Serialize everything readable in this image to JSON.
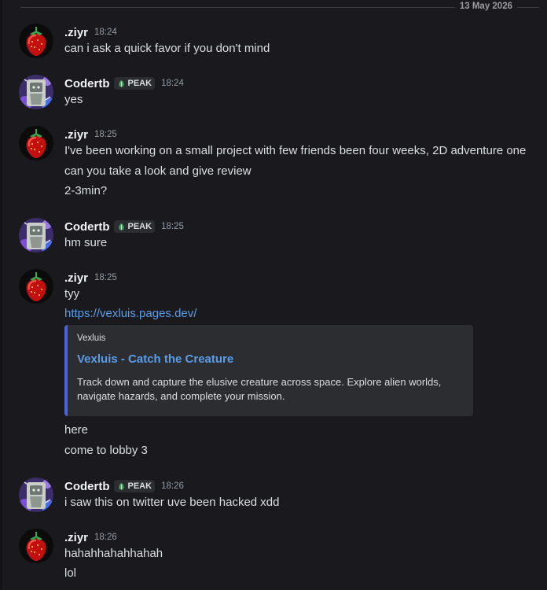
{
  "date_divider": "13 May 2026",
  "users": {
    "ziyr": {
      "name": ".ziyr",
      "avatar_icon": "strawberry-avatar-icon"
    },
    "codertb": {
      "name": "Codertb",
      "tag": "PEAK",
      "tag_icon": "leaf-badge-icon",
      "avatar_icon": "anime-avatar-icon"
    }
  },
  "messages": [
    {
      "author": ".ziyr",
      "time": "18:24",
      "lines": [
        "can i ask a quick favor if you don't mind"
      ]
    },
    {
      "author": "Codertb",
      "tag": "PEAK",
      "time": "18:24",
      "lines": [
        "yes"
      ]
    },
    {
      "author": ".ziyr",
      "time": "18:25",
      "lines": [
        "I've been working on a small project with few friends been four weeks, 2D adventure one",
        "can you take a look and give review",
        "2-3min?"
      ]
    },
    {
      "author": "Codertb",
      "tag": "PEAK",
      "time": "18:25",
      "lines": [
        "hm sure"
      ]
    },
    {
      "author": ".ziyr",
      "time": "18:25",
      "lines": [
        "tyy"
      ],
      "link": "https://vexluis.pages.dev/",
      "embed": {
        "provider": "Vexluis",
        "title": "Vexluis - Catch the Creature",
        "description": "Track down and capture the elusive creature across space. Explore alien worlds, navigate hazards, and complete your mission."
      },
      "after_lines": [
        "here",
        "come to lobby 3"
      ]
    },
    {
      "author": "Codertb",
      "tag": "PEAK",
      "time": "18:26",
      "lines": [
        "i saw this on twitter uve been hacked xdd"
      ]
    },
    {
      "author": ".ziyr",
      "time": "18:26",
      "lines": [
        "hahahhahahhahah",
        "lol"
      ]
    }
  ],
  "colors": {
    "background": "#1a1a1e",
    "link": "#5b9de8",
    "embed_accent": "#4a63d8",
    "embed_bg": "#2b2d31"
  }
}
